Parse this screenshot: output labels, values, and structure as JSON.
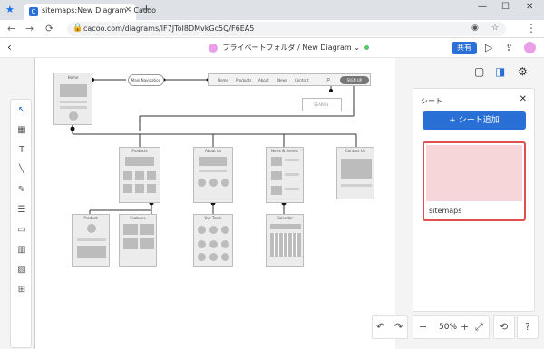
{
  "browser": {
    "tab_title": "sitemaps:New Diagram - Cacoo",
    "tab_close": "×",
    "new_tab": "+",
    "url": "cacoo.com/diagrams/lF7JToI8DMvkGc5Q/F6EA5",
    "win_min": "—",
    "win_max": "☐",
    "win_close": "✕",
    "nav_back": "←",
    "nav_fwd": "→",
    "nav_reload": "⟳",
    "menu": "⋮"
  },
  "app": {
    "back": "‹",
    "folder": "プライベートフォルダ",
    "separator": "/",
    "diagram_name": "New Diagram",
    "name_caret": "⌄",
    "share_label": "共有",
    "play_icon": "▷",
    "export_icon": "⇪"
  },
  "sheet_panel": {
    "header": "シート",
    "close": "✕",
    "add_label": "+ シート追加",
    "sheets": [
      {
        "name": "sitemaps"
      }
    ]
  },
  "bottom": {
    "undo": "↶",
    "redo": "↷",
    "zoom_out": "−",
    "zoom": "50%",
    "zoom_in": "+",
    "fit": "⤢",
    "history": "⟲",
    "help": "?"
  },
  "diagram": {
    "home": "Home",
    "main_nav": "Main Navigation",
    "nav_items": [
      "Home",
      "Products",
      "About",
      "News",
      "Contact"
    ],
    "signup": "SIGN UP",
    "search": "SEARCH",
    "pages": [
      "Products",
      "About Us",
      "News & Events",
      "Contact Us"
    ],
    "subpages": [
      "Product",
      "Features",
      "Our Team",
      "Calendar"
    ]
  }
}
